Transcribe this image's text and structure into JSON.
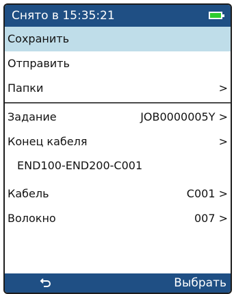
{
  "titlebar": {
    "title": "Снято в 15:35:21",
    "battery_icon": "battery-icon"
  },
  "menu": {
    "items": [
      {
        "label": "Сохранить",
        "selected": true
      },
      {
        "label": "Отправить"
      },
      {
        "label": "Папки",
        "arrow": ">"
      }
    ]
  },
  "details": {
    "job": {
      "label": "Задание",
      "value": "JOB0000005Y >"
    },
    "cable_end": {
      "label": "Конец кабеля",
      "value": ">"
    },
    "cable_end_value": "END100-END200-C001",
    "cable": {
      "label": "Кабель",
      "value": "C001 >"
    },
    "fiber": {
      "label": "Волокно",
      "value": "007 >"
    }
  },
  "bottombar": {
    "back_icon": "back-arrow-icon",
    "select_label": "Выбрать"
  },
  "colors": {
    "header_bg": "#1f4f84",
    "selected_bg": "#bfdde9",
    "battery": "#2ecc2e"
  }
}
